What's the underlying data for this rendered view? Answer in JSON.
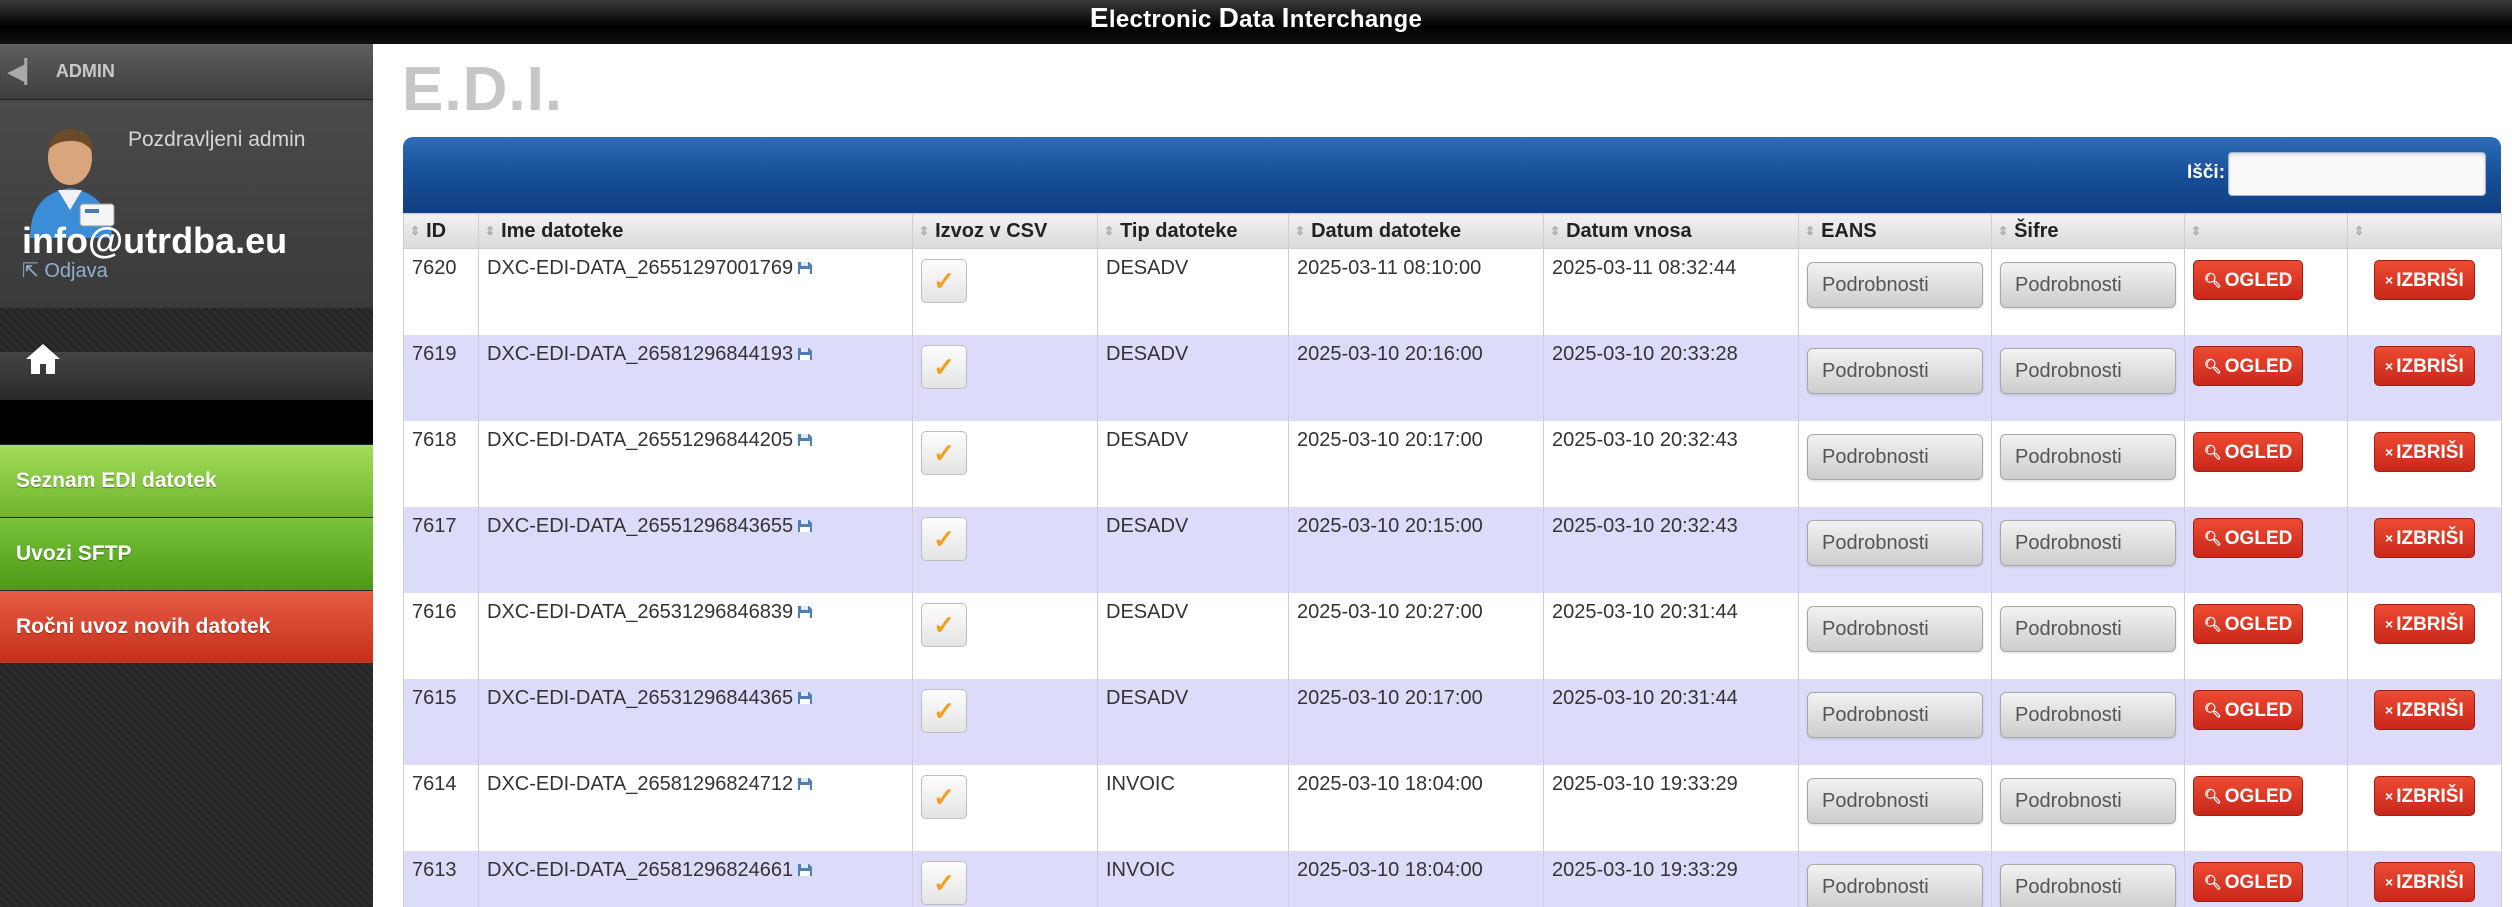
{
  "topbar": {
    "title_parts": [
      {
        "cap": "E",
        "rest": "lectronic "
      },
      {
        "cap": "D",
        "rest": "ata "
      },
      {
        "cap": "I",
        "rest": "nterchange"
      }
    ]
  },
  "sidebar": {
    "admin_label": "ADMIN",
    "greeting": "Pozdravljeni admin",
    "email": "info@utrdba.eu",
    "logout": "Odjava",
    "nav": [
      {
        "label": "Seznam EDI datotek",
        "color": "#8cc943"
      },
      {
        "label": "Uvozi SFTP",
        "color": "#5ca821"
      },
      {
        "label": "Ročni uvoz novih datotek",
        "color": "#d9402b"
      }
    ]
  },
  "main": {
    "title": "E.D.I.",
    "search": {
      "label": "Išči:",
      "value": ""
    },
    "columns": [
      "ID",
      "Ime datoteke",
      "Izvoz v CSV",
      "Tip datoteke",
      "Datum datoteke",
      "Datum vnosa",
      "EANS",
      "Šifre",
      "",
      ""
    ],
    "button_labels": {
      "details": "Podrobnosti",
      "view": "OGLED",
      "delete": "IZBRIŠI",
      "check": "✓"
    },
    "rows": [
      {
        "id": "7620",
        "file": "DXC-EDI-DATA_26551297001769",
        "type": "DESADV",
        "file_date": "2025-03-11 08:10:00",
        "entry_date": "2025-03-11 08:32:44"
      },
      {
        "id": "7619",
        "file": "DXC-EDI-DATA_26581296844193",
        "type": "DESADV",
        "file_date": "2025-03-10 20:16:00",
        "entry_date": "2025-03-10 20:33:28"
      },
      {
        "id": "7618",
        "file": "DXC-EDI-DATA_26551296844205",
        "type": "DESADV",
        "file_date": "2025-03-10 20:17:00",
        "entry_date": "2025-03-10 20:32:43"
      },
      {
        "id": "7617",
        "file": "DXC-EDI-DATA_26551296843655",
        "type": "DESADV",
        "file_date": "2025-03-10 20:15:00",
        "entry_date": "2025-03-10 20:32:43"
      },
      {
        "id": "7616",
        "file": "DXC-EDI-DATA_26531296846839",
        "type": "DESADV",
        "file_date": "2025-03-10 20:27:00",
        "entry_date": "2025-03-10 20:31:44"
      },
      {
        "id": "7615",
        "file": "DXC-EDI-DATA_26531296844365",
        "type": "DESADV",
        "file_date": "2025-03-10 20:17:00",
        "entry_date": "2025-03-10 20:31:44"
      },
      {
        "id": "7614",
        "file": "DXC-EDI-DATA_26581296824712",
        "type": "INVOIC",
        "file_date": "2025-03-10 18:04:00",
        "entry_date": "2025-03-10 19:33:29"
      },
      {
        "id": "7613",
        "file": "DXC-EDI-DATA_26581296824661",
        "type": "INVOIC",
        "file_date": "2025-03-10 18:04:00",
        "entry_date": "2025-03-10 19:33:29"
      }
    ]
  }
}
